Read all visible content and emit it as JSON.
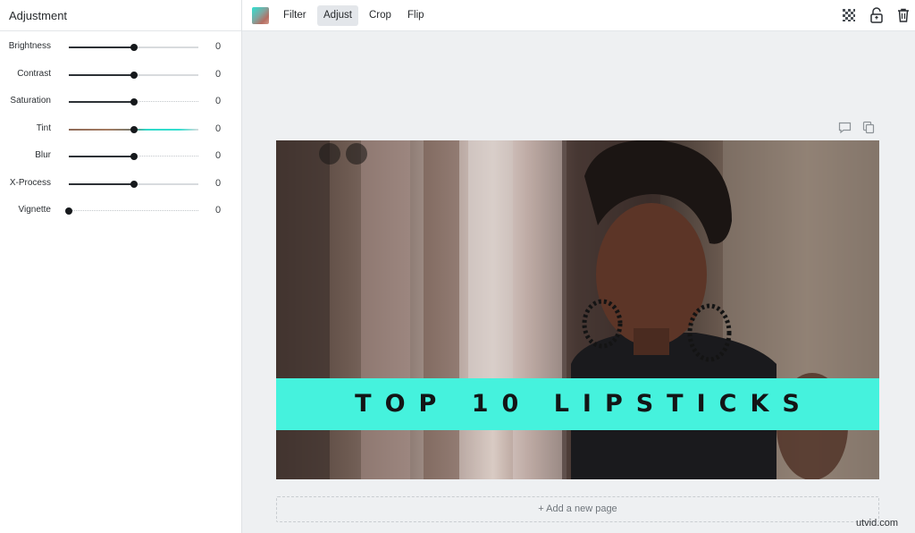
{
  "panel": {
    "title": "Adjustment",
    "sliders": [
      {
        "label": "Brightness",
        "value": "0",
        "level": 0.5
      },
      {
        "label": "Contrast",
        "value": "0",
        "level": 0.5
      },
      {
        "label": "Saturation",
        "value": "0",
        "level": 0.5
      },
      {
        "label": "Tint",
        "value": "0",
        "level": 0.5
      },
      {
        "label": "Blur",
        "value": "0",
        "level": 0.5
      },
      {
        "label": "X-Process",
        "value": "0",
        "level": 0.5
      },
      {
        "label": "Vignette",
        "value": "0",
        "level": 0.0
      }
    ]
  },
  "toolbar": {
    "tabs": [
      {
        "label": "Filter",
        "active": false
      },
      {
        "label": "Adjust",
        "active": true
      },
      {
        "label": "Crop",
        "active": false
      },
      {
        "label": "Flip",
        "active": false
      }
    ],
    "icons": [
      "transparency-icon",
      "unlock-icon",
      "trash-icon"
    ]
  },
  "canvas": {
    "icons": [
      "comment-icon",
      "duplicate-icon"
    ],
    "banner_text": "TOP 10 LIPSTICKS",
    "banner_color": "#45f2dd",
    "add_page_label": "+ Add a new page"
  },
  "watermark": "utvid.com"
}
